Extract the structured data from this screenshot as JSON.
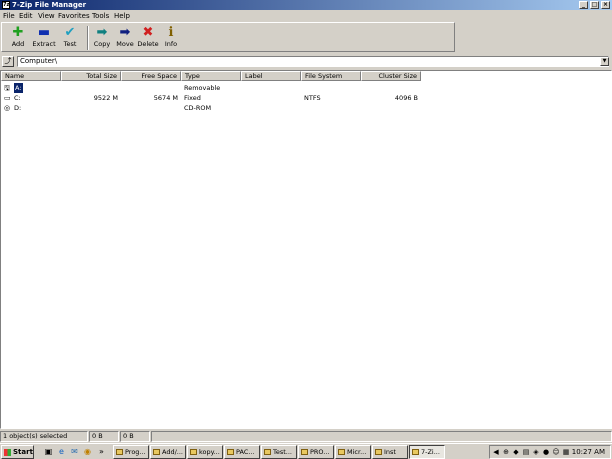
{
  "window": {
    "title": "7-Zip File Manager"
  },
  "menu": [
    "File",
    "Edit",
    "View",
    "Favorites",
    "Tools",
    "Help"
  ],
  "toolbar": {
    "add": "Add",
    "extract": "Extract",
    "test": "Test",
    "copy": "Copy",
    "move": "Move",
    "delete": "Delete",
    "info": "Info"
  },
  "address": {
    "value": "Computer\\"
  },
  "columns": [
    "Name",
    "Total Size",
    "Free Space",
    "Type",
    "Label",
    "File System",
    "Cluster Size"
  ],
  "rows": [
    {
      "name": "A:",
      "total": "",
      "free": "",
      "type": "Removable",
      "label": "",
      "fs": "",
      "cluster": ""
    },
    {
      "name": "C:",
      "total": "9522 M",
      "free": "5674 M",
      "type": "Fixed",
      "label": "",
      "fs": "NTFS",
      "cluster": "4096 B"
    },
    {
      "name": "D:",
      "total": "",
      "free": "",
      "type": "CD-ROM",
      "label": "",
      "fs": "",
      "cluster": ""
    }
  ],
  "status": {
    "selected": "1 object(s) selected",
    "size1": "0 B",
    "size2": "0 B"
  },
  "taskbar": {
    "start": "Start",
    "tasks": [
      "Prog...",
      "Add/...",
      "kopy...",
      "PAC...",
      "Test...",
      "PRO...",
      "Micr...",
      "Inst",
      "7-Zi..."
    ],
    "clock": "10:27 AM"
  },
  "colors": {
    "titlebar": "#0a246a",
    "selection": "#0a246a",
    "face": "#d4d0c8"
  }
}
